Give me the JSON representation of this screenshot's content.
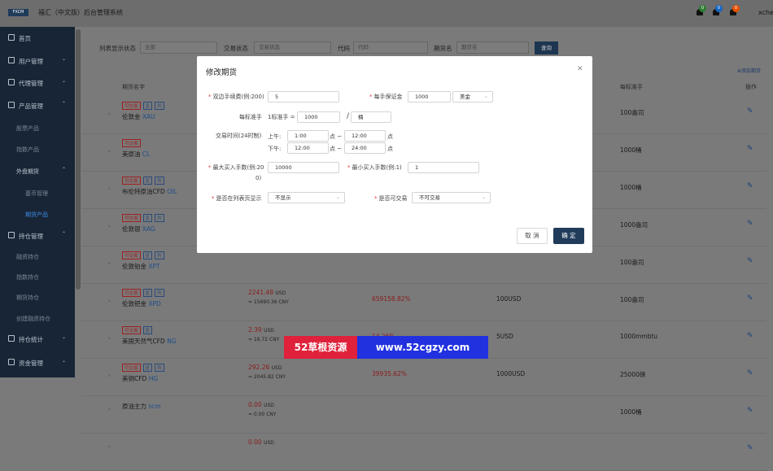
{
  "header": {
    "logo": "FXCM",
    "title": "福汇（中文版）后台管理系统",
    "notifications": [
      {
        "count": "0",
        "color": "#2e7d32"
      },
      {
        "count": "0",
        "color": "#1565c0"
      },
      {
        "count": "0",
        "color": "#e65100"
      }
    ],
    "user": "xche"
  },
  "sidebar": {
    "items": [
      {
        "label": "首页",
        "icon": "home-icon"
      },
      {
        "label": "用户管理",
        "icon": "user-icon"
      },
      {
        "label": "代理管理",
        "icon": "agent-icon"
      },
      {
        "label": "产品管理",
        "icon": "product-icon"
      },
      {
        "label": "股票产品"
      },
      {
        "label": "指数产品"
      },
      {
        "label": "外盘期货"
      },
      {
        "label": "基币管理"
      },
      {
        "label": "期货产品"
      },
      {
        "label": "持仓管理",
        "icon": "position-icon"
      },
      {
        "label": "融资持仓"
      },
      {
        "label": "指数持仓"
      },
      {
        "label": "期货持仓"
      },
      {
        "label": "创建融资持仓"
      },
      {
        "label": "持仓统计",
        "icon": "stats-icon"
      },
      {
        "label": "资金管理",
        "icon": "funds-icon"
      }
    ]
  },
  "filter": {
    "list_display_label": "列表显示状态",
    "list_display_value": "全部",
    "trade_status_label": "交易状态",
    "trade_status_placeholder": "交易状态",
    "code_label": "代码",
    "code_placeholder": "代码",
    "futures_name_label": "期货名",
    "futures_name_placeholder": "期货名",
    "query_label": "查询",
    "add_label": "⊕添加期货"
  },
  "table": {
    "headers": [
      "期货名字",
      "每标准手",
      "操作"
    ],
    "rows": [
      {
        "tags": [
          "可交易",
          "显",
          "列"
        ],
        "name": "伦敦金",
        "code": "XAU",
        "price": "",
        "cny": "",
        "rate": "",
        "margin": "",
        "unit": "100盎司"
      },
      {
        "tags": [
          "可交易"
        ],
        "name": "美原油",
        "code": "CL",
        "price": "",
        "cny": "",
        "rate": "",
        "margin": "",
        "unit": "1000桶"
      },
      {
        "tags": [
          "可交易",
          "显",
          "列"
        ],
        "name": "布伦特原油CFD",
        "code": "OIL",
        "price": "",
        "cny": "",
        "rate": "",
        "margin": "",
        "unit": "1000桶"
      },
      {
        "tags": [
          "可交易",
          "显",
          "列"
        ],
        "name": "伦敦银",
        "code": "XAG",
        "price": "",
        "cny": "",
        "rate": "",
        "margin": "",
        "unit": "1000盎司"
      },
      {
        "tags": [
          "可交易",
          "显",
          "列"
        ],
        "name": "伦敦铂金",
        "code": "XPT",
        "price": "",
        "cny": "",
        "rate": "",
        "margin": "",
        "unit": "100盎司"
      },
      {
        "tags": [
          "可交易",
          "显",
          "列"
        ],
        "name": "伦敦钯金",
        "code": "XPD",
        "price": "2241.48",
        "cny": "≈ 15690.36 CNY",
        "rate": "659158.82%",
        "margin": "100USD",
        "unit": "100盎司"
      },
      {
        "tags": [
          "可交易",
          "显"
        ],
        "name": "美国天然气CFD",
        "code": "NG",
        "price": "2.39",
        "cny": "≈ 16.72 CNY",
        "rate": "14.26%",
        "margin": "5USD",
        "unit": "1000mmbtu"
      },
      {
        "tags": [
          "可交易",
          "显",
          "列"
        ],
        "name": "美铜CFD",
        "code": "HG",
        "price": "292.26",
        "cny": "≈ 2045.82 CNY",
        "rate": "39935.62%",
        "margin": "1000USD",
        "unit": "25000磅"
      },
      {
        "tags": [],
        "name": "原油主力",
        "code": "scm",
        "price": "0.00",
        "cny": "≈ 0.00 CNY",
        "rate": "",
        "margin": "",
        "unit": "1000桶"
      },
      {
        "tags": [],
        "name": "",
        "code": "",
        "price": "0.00",
        "cny": "",
        "rate": "",
        "margin": "",
        "unit": ""
      }
    ],
    "currency_unit": "USD"
  },
  "modal": {
    "title": "修改期货",
    "fee_label": "双边手续费(例:200)",
    "fee_value": "5",
    "margin_label": "每手保证金",
    "margin_value": "1000",
    "margin_currency": "美金",
    "std_label": "每标准手",
    "std_prefix": "1标准手 =",
    "std_value": "1000",
    "std_sep": "/",
    "std_unit": "桶",
    "time_label": "交易时间(24时制)",
    "am_label": "上午:",
    "am_start": "1:00",
    "am_end": "12:00",
    "pm_label": "下午:",
    "pm_start": "12:00",
    "pm_end": "24:00",
    "dot_tilde": "点 ~",
    "dot": "点",
    "max_label": "最大买入手数(例:20",
    "max_label2": "0)",
    "max_value": "10000",
    "min_label": "最小买入手数(例:1)",
    "min_value": "1",
    "show_label": "是否在列表页显示",
    "show_value": "不显示",
    "trade_label": "是否可交易",
    "trade_value": "不可交易",
    "cancel_label": "取 消",
    "ok_label": "确 定"
  },
  "banner": {
    "left": "52草根资源",
    "right": "www.52cgzy.com"
  }
}
